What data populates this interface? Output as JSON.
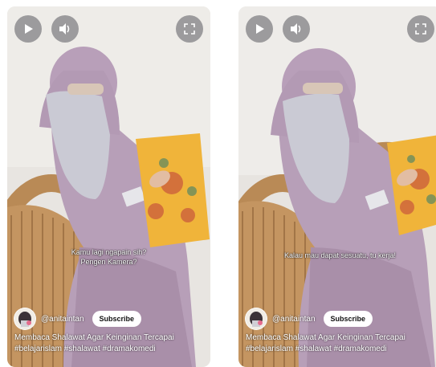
{
  "videos": [
    {
      "caption": [
        "Kamu lagi ngapain sih?",
        "Pengen Kamera?"
      ],
      "channel": "@anitaintan",
      "subscribe_label": "Subscribe",
      "description": [
        "Membaca Shalawat Agar Keinginan Tercapai",
        "#belajarislam #shalawat #dramakomedi"
      ],
      "controls": {
        "play": "play-icon",
        "volume": "volume-icon",
        "fullscreen": "fullscreen-icon"
      }
    },
    {
      "caption": [
        "Kalau mau dapat sesuatu, tu kerja!"
      ],
      "channel": "@anitaintan",
      "subscribe_label": "Subscribe",
      "description": [
        "Membaca Shalawat Agar Keinginan Tercapai",
        "#belajarislam #shalawat #dramakomedi"
      ],
      "controls": {
        "play": "play-icon",
        "volume": "volume-icon",
        "fullscreen": "fullscreen-icon"
      }
    }
  ],
  "colors": {
    "robe": "#b79fb8",
    "niqab": "#c9c8d2",
    "chair": "#b98a56",
    "book": "#f0b43a",
    "wall": "#e9e6e2"
  }
}
